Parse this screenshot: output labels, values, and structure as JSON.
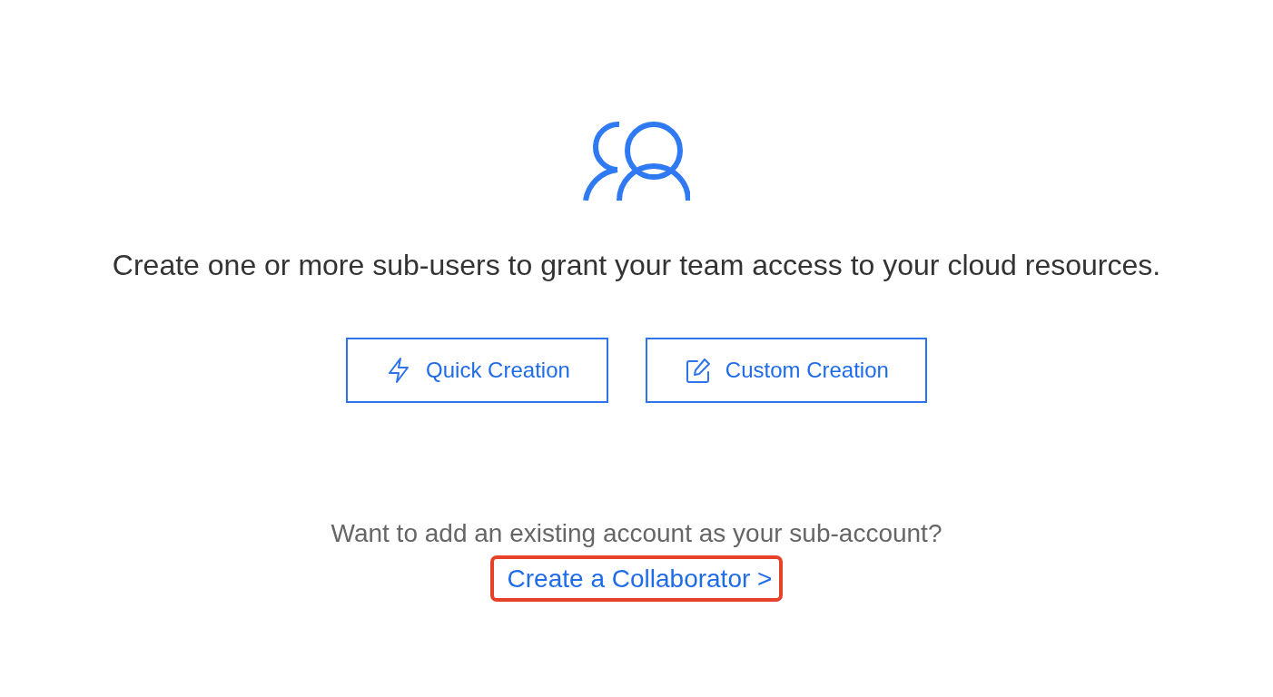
{
  "hero": {
    "message": "Create one or more sub-users to grant your team access to your cloud resources."
  },
  "actions": [
    {
      "kind": "quick",
      "label": "Quick Creation"
    },
    {
      "kind": "custom",
      "label": "Custom Creation"
    }
  ],
  "collaborator": {
    "question": "Want to add an existing account as your sub-account?",
    "link": {
      "label": "Create a Collaborator >",
      "highlighted": true
    }
  }
}
